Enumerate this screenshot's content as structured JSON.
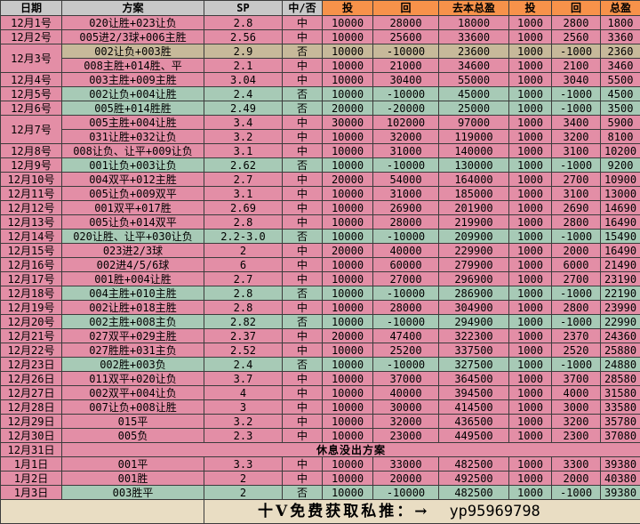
{
  "headers": [
    "日期",
    "方案",
    "SP",
    "中/否",
    "投",
    "回",
    "去本总盈",
    "投",
    "回",
    "总盈"
  ],
  "rows": [
    {
      "d": "12月1号",
      "c": [
        "020让胜+023让负",
        "2.8",
        "中",
        "10000",
        "28000",
        "18000",
        "1000",
        "2800",
        "1800"
      ],
      "t": "pink"
    },
    {
      "d": "12月2号",
      "c": [
        "005进2/3球+006主胜",
        "2.56",
        "中",
        "10000",
        "25600",
        "33600",
        "1000",
        "2560",
        "3360"
      ],
      "t": "pink"
    },
    {
      "d": "12月3号",
      "span": 2,
      "c": [
        "002让负+003胜",
        "2.9",
        "否",
        "10000",
        "-10000",
        "23600",
        "1000",
        "-1000",
        "2360"
      ],
      "t": "tan"
    },
    {
      "c": [
        "008主胜+014胜、平",
        "2.1",
        "中",
        "10000",
        "21000",
        "34600",
        "1000",
        "2100",
        "3460"
      ],
      "t": "pink"
    },
    {
      "d": "12月4号",
      "c": [
        "003主胜+009主胜",
        "3.04",
        "中",
        "10000",
        "30400",
        "55000",
        "1000",
        "3040",
        "5500"
      ],
      "t": "pink"
    },
    {
      "d": "12月5号",
      "c": [
        "002让负+004让胜",
        "2.4",
        "否",
        "10000",
        "-10000",
        "45000",
        "1000",
        "-1000",
        "4500"
      ],
      "t": "green"
    },
    {
      "d": "12月6号",
      "c": [
        "005胜+014胜胜",
        "2.49",
        "否",
        "20000",
        "-20000",
        "25000",
        "1000",
        "-1000",
        "3500"
      ],
      "t": "green"
    },
    {
      "d": "12月7号",
      "span": 2,
      "c": [
        "005主胜+004让胜",
        "3.4",
        "中",
        "30000",
        "102000",
        "97000",
        "1000",
        "3400",
        "5900"
      ],
      "t": "pink"
    },
    {
      "c": [
        "031让胜+032让负",
        "3.2",
        "中",
        "10000",
        "32000",
        "119000",
        "1000",
        "3200",
        "8100"
      ],
      "t": "pink"
    },
    {
      "d": "12月8号",
      "c": [
        "008让负、让平+009让负",
        "3.1",
        "中",
        "10000",
        "31000",
        "140000",
        "1000",
        "3100",
        "10200"
      ],
      "t": "pink"
    },
    {
      "d": "12月9号",
      "c": [
        "001让负+003让负",
        "2.62",
        "否",
        "10000",
        "-10000",
        "130000",
        "1000",
        "-1000",
        "9200"
      ],
      "t": "green"
    },
    {
      "d": "12月10号",
      "c": [
        "004双平+012主胜",
        "2.7",
        "中",
        "20000",
        "54000",
        "164000",
        "1000",
        "2700",
        "10900"
      ],
      "t": "pink"
    },
    {
      "d": "12月11号",
      "c": [
        "005让负+009双平",
        "3.1",
        "中",
        "10000",
        "31000",
        "185000",
        "1000",
        "3100",
        "13000"
      ],
      "t": "pink"
    },
    {
      "d": "12月12号",
      "c": [
        "001双平+017胜",
        "2.69",
        "中",
        "10000",
        "26900",
        "201900",
        "1000",
        "2690",
        "14690"
      ],
      "t": "pink"
    },
    {
      "d": "12月13号",
      "c": [
        "005让负+014双平",
        "2.8",
        "中",
        "10000",
        "28000",
        "219900",
        "1000",
        "2800",
        "16490"
      ],
      "t": "pink"
    },
    {
      "d": "12月14号",
      "c": [
        "020让胜、让平+030让负",
        "2.2-3.0",
        "否",
        "10000",
        "-10000",
        "209900",
        "1000",
        "-1000",
        "15490"
      ],
      "t": "green"
    },
    {
      "d": "12月15号",
      "c": [
        "023进2/3球",
        "2",
        "中",
        "20000",
        "40000",
        "229900",
        "1000",
        "2000",
        "16490"
      ],
      "t": "pink"
    },
    {
      "d": "12月16号",
      "c": [
        "002进4/5/6球",
        "6",
        "中",
        "10000",
        "60000",
        "279900",
        "1000",
        "6000",
        "21490"
      ],
      "t": "pink"
    },
    {
      "d": "12月17号",
      "c": [
        "001胜+004让胜",
        "2.7",
        "中",
        "10000",
        "27000",
        "296900",
        "1000",
        "2700",
        "23190"
      ],
      "t": "pink"
    },
    {
      "d": "12月18号",
      "c": [
        "004主胜+010主胜",
        "2.8",
        "否",
        "10000",
        "-10000",
        "286900",
        "1000",
        "-1000",
        "22190"
      ],
      "t": "green"
    },
    {
      "d": "12月19号",
      "c": [
        "002让胜+018主胜",
        "2.8",
        "中",
        "10000",
        "28000",
        "304900",
        "1000",
        "2800",
        "23990"
      ],
      "t": "pink"
    },
    {
      "d": "12月20号",
      "c": [
        "002主胜+008主负",
        "2.82",
        "否",
        "10000",
        "-10000",
        "294900",
        "1000",
        "-1000",
        "22990"
      ],
      "t": "green"
    },
    {
      "d": "12月21号",
      "c": [
        "027双平+029主胜",
        "2.37",
        "中",
        "20000",
        "47400",
        "322300",
        "1000",
        "2370",
        "24360"
      ],
      "t": "pink"
    },
    {
      "d": "12月22号",
      "c": [
        "027胜胜+031主负",
        "2.52",
        "中",
        "10000",
        "25200",
        "337500",
        "1000",
        "2520",
        "25880"
      ],
      "t": "pink"
    },
    {
      "d": "12月23日",
      "c": [
        "002胜+003负",
        "2.4",
        "否",
        "10000",
        "-10000",
        "327500",
        "1000",
        "-1000",
        "24880"
      ],
      "t": "green"
    },
    {
      "d": "12月26日",
      "c": [
        "011双平+020让负",
        "3.7",
        "中",
        "10000",
        "37000",
        "364500",
        "1000",
        "3700",
        "28580"
      ],
      "t": "pink"
    },
    {
      "d": "12月27日",
      "c": [
        "002双平+004让负",
        "4",
        "中",
        "10000",
        "40000",
        "394500",
        "1000",
        "4000",
        "31580"
      ],
      "t": "pink"
    },
    {
      "d": "12月28日",
      "c": [
        "007让负+008让胜",
        "3",
        "中",
        "10000",
        "30000",
        "414500",
        "1000",
        "3000",
        "33580"
      ],
      "t": "pink"
    },
    {
      "d": "12月29日",
      "c": [
        "015平",
        "3.2",
        "中",
        "10000",
        "32000",
        "436500",
        "1000",
        "3200",
        "35780"
      ],
      "t": "pink"
    },
    {
      "d": "12月30日",
      "c": [
        "005负",
        "2.3",
        "中",
        "10000",
        "23000",
        "449500",
        "1000",
        "2300",
        "37080"
      ],
      "t": "pink"
    },
    {
      "d": "12月31日",
      "rest": "休息没出方案",
      "t": "pink"
    },
    {
      "d": "1月1日",
      "c": [
        "001平",
        "3.3",
        "中",
        "10000",
        "33000",
        "482500",
        "1000",
        "3300",
        "39380"
      ],
      "t": "pink"
    },
    {
      "d": "1月2日",
      "c": [
        "001胜",
        "2",
        "中",
        "10000",
        "20000",
        "492500",
        "1000",
        "2000",
        "40380"
      ],
      "t": "pink"
    },
    {
      "d": "1月3日",
      "c": [
        "003胜平",
        "2",
        "否",
        "10000",
        "-10000",
        "482500",
        "1000",
        "-1000",
        "39380"
      ],
      "t": "green"
    }
  ],
  "footer": {
    "text": "十V免费获取私推：→",
    "code": "yp95969798"
  },
  "colors": {
    "pink": "#e38ea6",
    "green": "#a7cab6",
    "tan": "#c7b99a",
    "orange": "#f7924a",
    "gray": "#c8c8c8"
  }
}
